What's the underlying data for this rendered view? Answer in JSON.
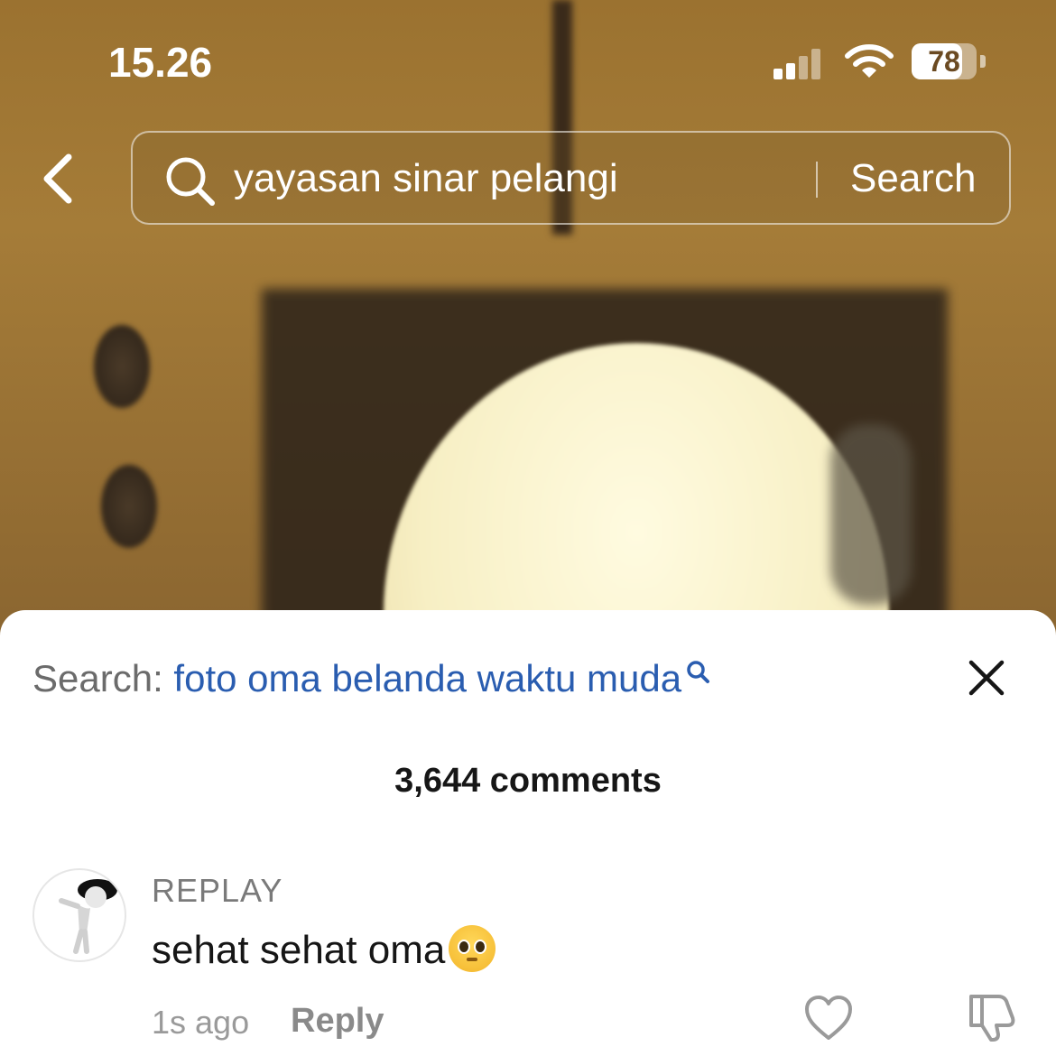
{
  "status_bar": {
    "time": "15.26",
    "battery": "78",
    "battery_level_percent": 78
  },
  "search_bar": {
    "query": "yayasan sinar pelangi",
    "search_button_label": "Search"
  },
  "comments_sheet": {
    "search_prefix": "Search:",
    "search_term": "foto oma belanda waktu muda",
    "comment_count": "3,644 comments",
    "comments": [
      {
        "username": "REPLAY",
        "text": "sehat sehat oma",
        "emoji": "pleading-face",
        "timestamp": "1s ago",
        "reply_label": "Reply"
      }
    ]
  },
  "icons": {
    "back": "chevron-left-icon",
    "search": "search-icon",
    "close": "close-icon",
    "like": "heart-icon",
    "dislike": "thumbs-down-icon"
  },
  "colors": {
    "link_blue": "#2a5db0",
    "sheet_bg": "#ffffff",
    "muted_text": "#7a7a7a"
  }
}
